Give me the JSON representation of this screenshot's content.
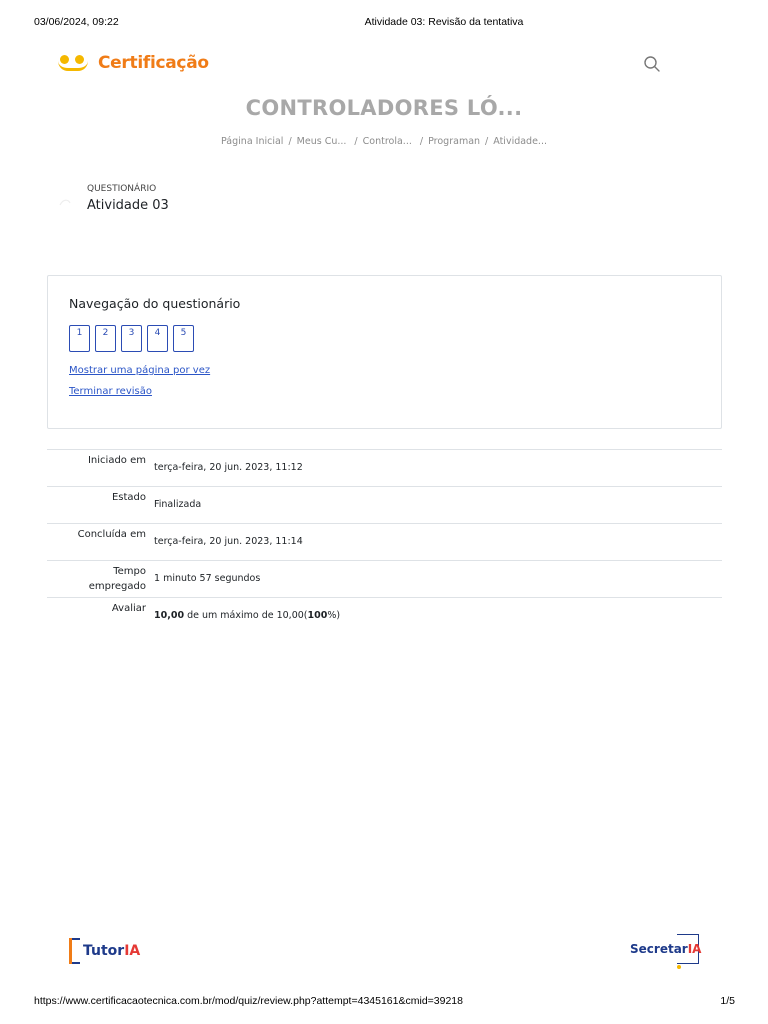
{
  "print_header": {
    "datetime": "03/06/2024, 09:22",
    "page_title": "Atividade 03: Revisão da tentativa"
  },
  "print_footer": {
    "url": "https://www.certificacaotecnica.com.br/mod/quiz/review.php?attempt=4345161&cmid=39218",
    "page_number": "1/5"
  },
  "navbar": {
    "logo_text": "Certificação",
    "search_icon": "search-icon"
  },
  "course": {
    "title": "CONTROLADORES LÓ..."
  },
  "breadcrumb": {
    "items": [
      "Página Inicial",
      "Meus Cu...",
      "Controla...",
      "Programan",
      "Atividade..."
    ]
  },
  "activity": {
    "kind": "QUESTIONÁRIO",
    "name": "Atividade 03"
  },
  "quiz_navigation": {
    "title": "Navegação do questionário",
    "questions": [
      "1",
      "2",
      "3",
      "4",
      "5"
    ],
    "show_one_page_link": "Mostrar uma página por vez",
    "finish_review_link": "Terminar revisão"
  },
  "summary": {
    "started_label": "Iniciado em",
    "started_value": "terça-feira, 20 jun. 2023, 11:12",
    "state_label": "Estado",
    "state_value": "Finalizada",
    "completed_label": "Concluída em",
    "completed_value": "terça-feira, 20 jun. 2023, 11:14",
    "time_label_line1": "Tempo",
    "time_label_line2": "empregado",
    "time_value": "1 minuto 57 segundos",
    "grade_label": "Avaliar",
    "grade_score": "10,00",
    "grade_middle": " de um máximo de 10,00(",
    "grade_percent": "100",
    "grade_end": "%)"
  },
  "footer_logos": {
    "left_main": "Tutor",
    "left_accent": "IA",
    "right_main": "Secretar",
    "right_accent": "IA"
  },
  "colors": {
    "brand_orange": "#f07c17",
    "brand_yellow": "#f5b800",
    "link_blue": "#2b55c7",
    "title_gray": "#a8a8a8"
  }
}
